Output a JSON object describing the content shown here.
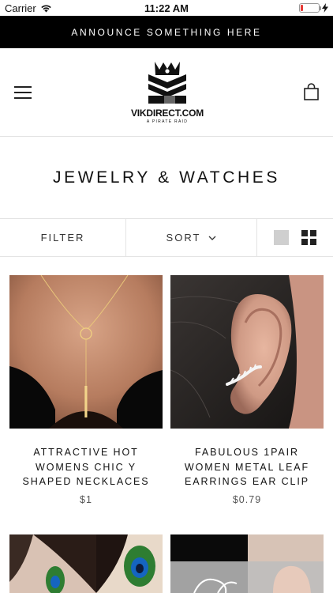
{
  "status_bar": {
    "carrier": "Carrier",
    "time": "11:22 AM",
    "battery_level": 0.12
  },
  "announcement": {
    "text": "ANNOUNCE SOMETHING HERE"
  },
  "header": {
    "logo_name": "VIKDIRECT.COM",
    "logo_tagline": "A PIRATE RAID",
    "menu_icon": "hamburger-icon",
    "cart_icon": "shopping-bag-icon"
  },
  "collection": {
    "title": "JEWELRY & WATCHES"
  },
  "toolbar": {
    "filter_label": "FILTER",
    "sort_label": "SORT",
    "sort_icon": "chevron-down-icon",
    "view_options": [
      "single-column",
      "grid"
    ],
    "active_view": "grid"
  },
  "products": [
    {
      "title": "ATTRACTIVE HOT WOMENS CHIC Y SHAPED NECKLACES",
      "price": "$1"
    },
    {
      "title": "FABULOUS 1PAIR WOMEN METAL LEAF EARRINGS EAR CLIP",
      "price": "$0.79"
    },
    {
      "title": "",
      "price": ""
    },
    {
      "title": "",
      "price": ""
    }
  ]
}
